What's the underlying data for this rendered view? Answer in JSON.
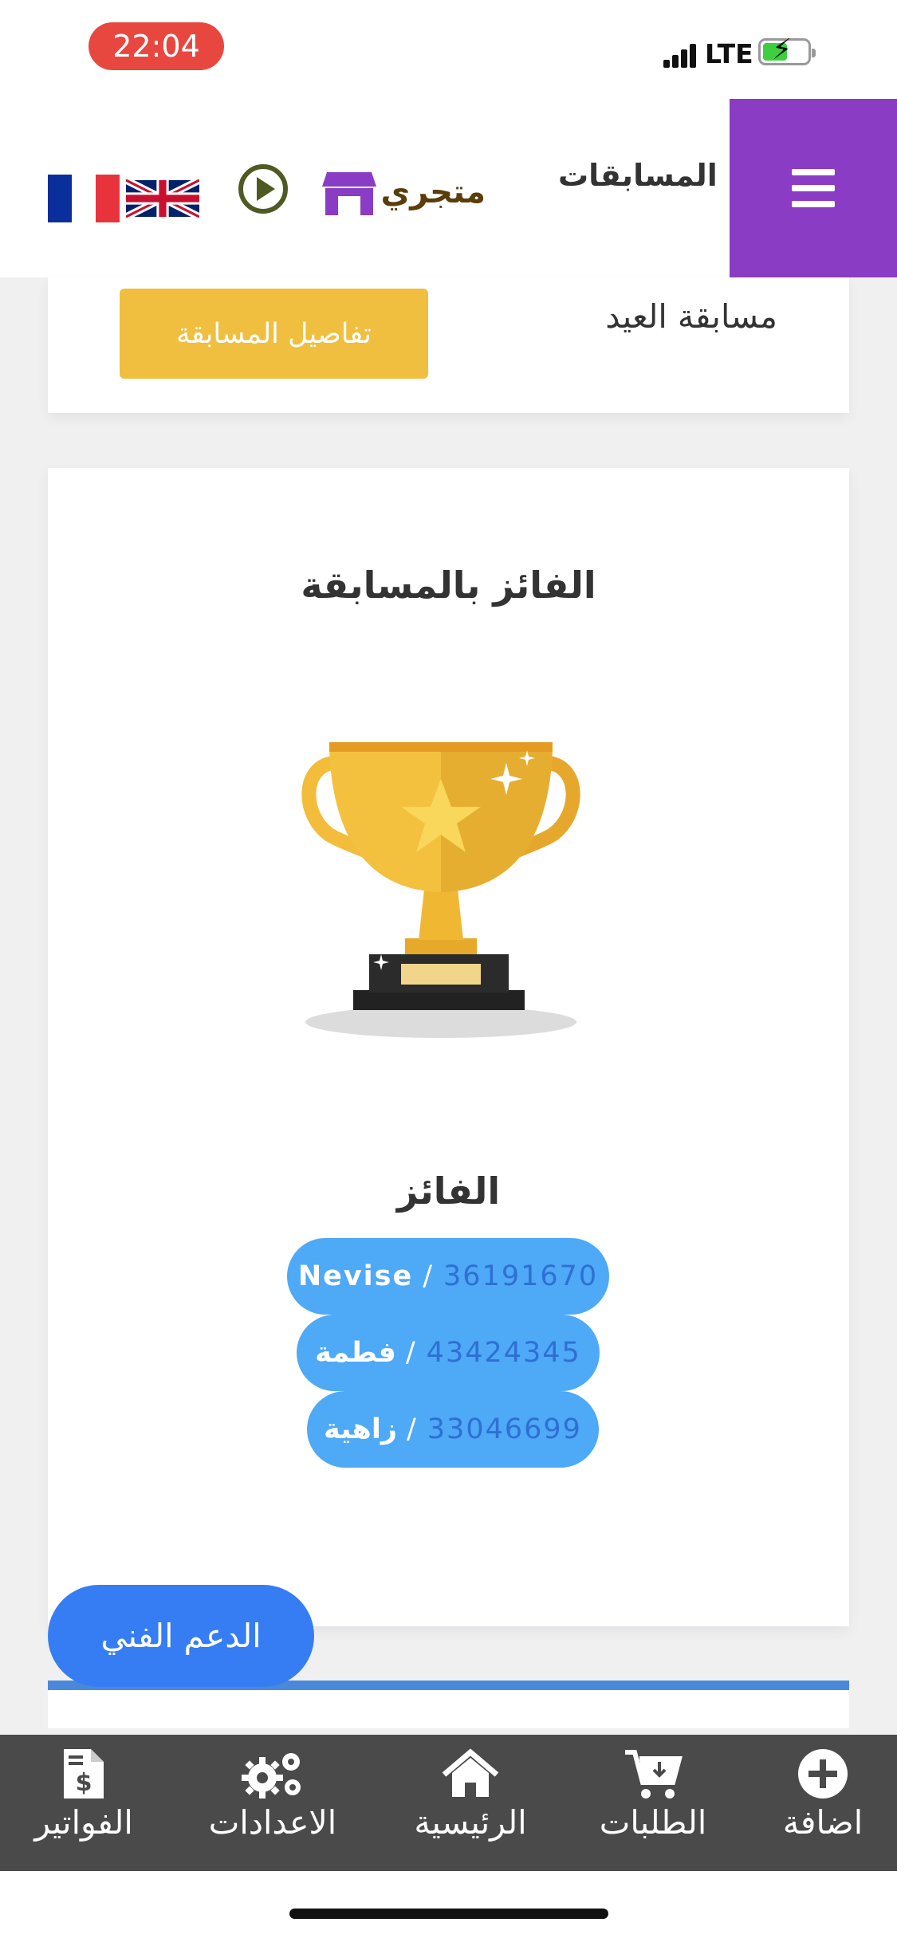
{
  "status_bar": {
    "time": "22:04",
    "network": "LTE",
    "time_pill_color": "#e8473f"
  },
  "header": {
    "title": "المسابقات",
    "store_label": "متجري",
    "menu_color": "#8b3cc5",
    "icons": [
      "menu-icon",
      "store-icon",
      "play-icon",
      "uk-flag-icon",
      "france-flag-icon"
    ]
  },
  "competition": {
    "name": "مسابقة العيد",
    "details_button": "تفاصيل المسابقة",
    "button_color": "#f0bf40"
  },
  "winner_section": {
    "title": "الفائز بالمسابقة",
    "winner_label": "الفائز",
    "winners": [
      {
        "name": "Nevise",
        "phone": "36191670"
      },
      {
        "name": "فطمة",
        "phone": "43424345"
      },
      {
        "name": "زاهية",
        "phone": "33046699"
      }
    ],
    "pill_color": "#4ea9f6"
  },
  "support": {
    "label": "الدعم الفني",
    "color": "#367df3"
  },
  "bottom_nav": {
    "items": [
      {
        "label": "اضافة",
        "icon": "plus-circle-icon"
      },
      {
        "label": "الطلبات",
        "icon": "cart-icon"
      },
      {
        "label": "الرئيسية",
        "icon": "home-icon"
      },
      {
        "label": "الاعدادات",
        "icon": "gears-icon"
      },
      {
        "label": "الفواتير",
        "icon": "invoice-icon"
      }
    ],
    "background": "#4a4a4a"
  }
}
